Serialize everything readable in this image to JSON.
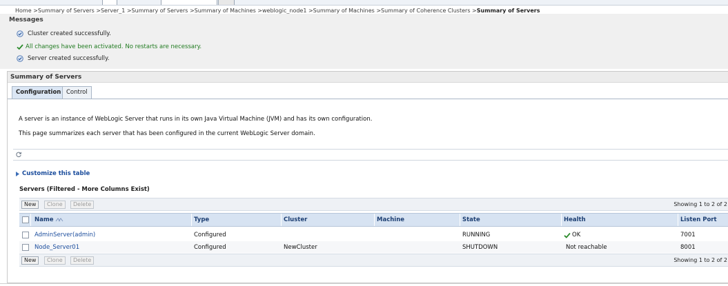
{
  "breadcrumb": {
    "prefix": "Home >Summary of Servers >Server_1 >Summary of Servers >Summary of Machines >weblogic_node1 >Summary of Machines >Summary of Coherence Clusters >",
    "current": "Summary of Servers"
  },
  "messages": {
    "header": "Messages",
    "items": [
      {
        "icon": "info-icon",
        "text": "Cluster created successfully."
      },
      {
        "icon": "check-icon",
        "text": "All changes have been activated. No restarts are necessary.",
        "color": "#1f7a1f"
      },
      {
        "icon": "info-icon",
        "text": "Server created successfully."
      }
    ]
  },
  "panel": {
    "title": "Summary of Servers",
    "tabs": [
      {
        "label": "Configuration",
        "active": true
      },
      {
        "label": "Control",
        "active": false
      }
    ],
    "description": [
      "A server is an instance of WebLogic Server that runs in its own Java Virtual Machine (JVM) and has its own configuration.",
      "This page summarizes each server that has been configured in the current WebLogic Server domain."
    ],
    "customize_label": "Customize this table"
  },
  "table": {
    "title": "Servers (Filtered - More Columns Exist)",
    "buttons": {
      "new": "New",
      "clone": "Clone",
      "delete": "Delete"
    },
    "showing": "Showing 1 to 2 of 2",
    "columns": [
      "Name",
      "Type",
      "Cluster",
      "Machine",
      "State",
      "Health",
      "Listen Port"
    ],
    "rows": [
      {
        "name": "AdminServer(admin)",
        "type": "Configured",
        "cluster": "",
        "machine": "",
        "state": "RUNNING",
        "health": "OK",
        "health_icon": "check-icon",
        "port": "7001"
      },
      {
        "name": "Node_Server01",
        "type": "Configured",
        "cluster": "NewCluster",
        "machine": "",
        "state": "SHUTDOWN",
        "health": "Not reachable",
        "health_icon": "",
        "port": "8001"
      }
    ]
  },
  "colors": {
    "accent": "#1a4c9c",
    "header_bg": "#d7e3f2",
    "success": "#1f7a1f"
  }
}
